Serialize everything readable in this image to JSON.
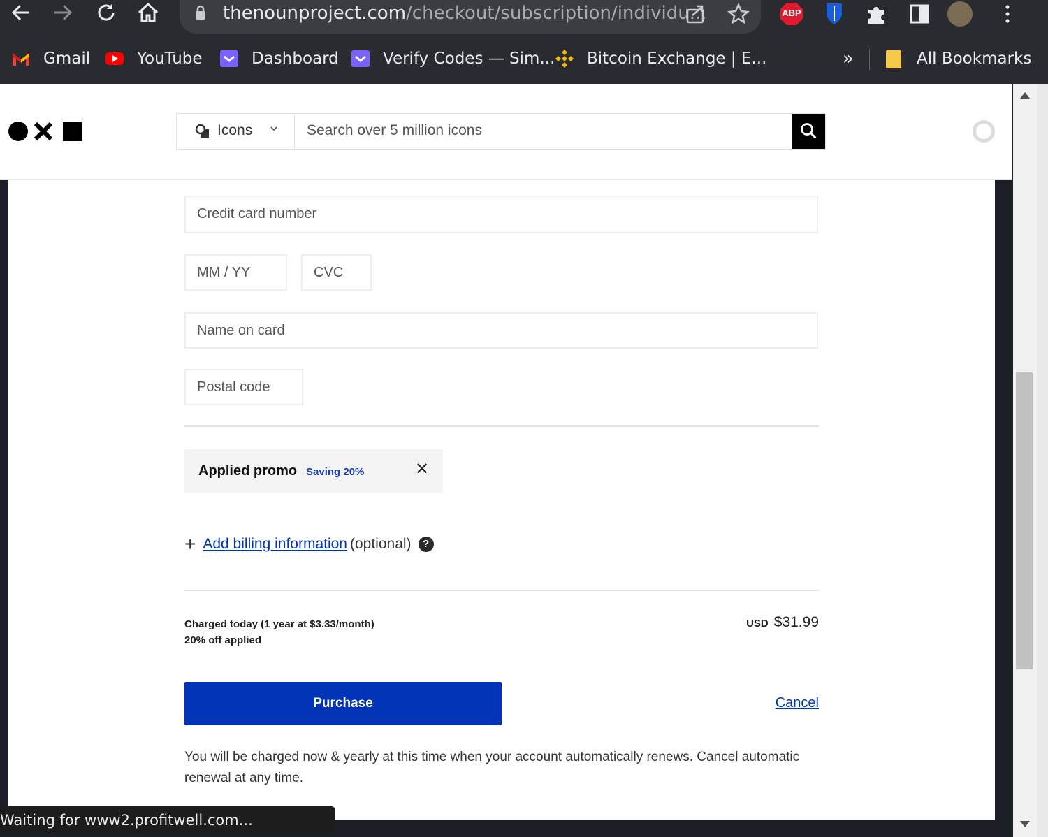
{
  "browser": {
    "url_host": "thenounproject.com",
    "url_path": "/checkout/subscription/individu...",
    "extensions": {
      "abp_label": "ABP"
    }
  },
  "bookmarks": [
    {
      "label": "Gmail",
      "icon": "gmail-icon"
    },
    {
      "label": "YouTube",
      "icon": "youtube-icon"
    },
    {
      "label": "Dashboard",
      "icon": "dashboard-icon"
    },
    {
      "label": "Verify Codes — Sim...",
      "icon": "verify-codes-icon"
    },
    {
      "label": "Bitcoin Exchange | E...",
      "icon": "binance-icon"
    }
  ],
  "bookmarks_overflow": "»",
  "all_bookmarks": "All Bookmarks",
  "site": {
    "search_category": "Icons",
    "search_placeholder": "Search over 5 million icons"
  },
  "form": {
    "card_number_placeholder": "Credit card number",
    "expiry_placeholder": "MM / YY",
    "cvc_placeholder": "CVC",
    "name_placeholder": "Name on card",
    "postal_placeholder": "Postal code"
  },
  "promo": {
    "title": "Applied promo",
    "saving": "Saving 20%",
    "remove": "✕"
  },
  "billing": {
    "plus": "+",
    "link": "Add billing information",
    "optional": "(optional)",
    "help": "?"
  },
  "summary": {
    "charged_line": "Charged today (1 year at $3.33/month)",
    "discount_line": "20% off applied",
    "currency": "USD",
    "amount": "$31.99"
  },
  "actions": {
    "purchase": "Purchase",
    "cancel": "Cancel"
  },
  "renewal_note": "You will be charged now & yearly at this time when your account automatically renews. Cancel automatic renewal at any time.",
  "status_bar": "Waiting for www2.profitwell.com...",
  "colors": {
    "accent_blue": "#0033b5",
    "chrome_dark": "#2a2b30",
    "omnibox": "#3c3d42"
  }
}
